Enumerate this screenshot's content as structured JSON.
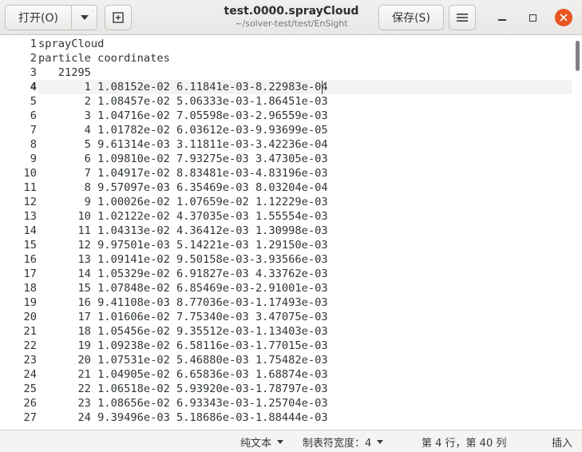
{
  "header": {
    "open_label": "打开(O)",
    "save_label": "保存(S)",
    "title": "test.0000.sprayCloud",
    "subtitle": "~/solver-test/test/EnSight"
  },
  "editor": {
    "current_line": 4,
    "lines": [
      {
        "n": "1",
        "text": "sprayCloud"
      },
      {
        "n": "2",
        "text": "particle coordinates"
      },
      {
        "n": "3",
        "text": "   21295"
      },
      {
        "n": "4",
        "text": "       1 1.08152e-02 6.11841e-03-8.22983e-04"
      },
      {
        "n": "5",
        "text": "       2 1.08457e-02 5.06333e-03-1.86451e-03"
      },
      {
        "n": "6",
        "text": "       3 1.04716e-02 7.05598e-03-2.96559e-03"
      },
      {
        "n": "7",
        "text": "       4 1.01782e-02 6.03612e-03-9.93699e-05"
      },
      {
        "n": "8",
        "text": "       5 9.61314e-03 3.11811e-03-3.42236e-04"
      },
      {
        "n": "9",
        "text": "       6 1.09810e-02 7.93275e-03 3.47305e-03"
      },
      {
        "n": "10",
        "text": "       7 1.04917e-02 8.83481e-03-4.83196e-03"
      },
      {
        "n": "11",
        "text": "       8 9.57097e-03 6.35469e-03 8.03204e-04"
      },
      {
        "n": "12",
        "text": "       9 1.00026e-02 1.07659e-02 1.12229e-03"
      },
      {
        "n": "13",
        "text": "      10 1.02122e-02 4.37035e-03 1.55554e-03"
      },
      {
        "n": "14",
        "text": "      11 1.04313e-02 4.36412e-03 1.30998e-03"
      },
      {
        "n": "15",
        "text": "      12 9.97501e-03 5.14221e-03 1.29150e-03"
      },
      {
        "n": "16",
        "text": "      13 1.09141e-02 9.50158e-03-3.93566e-03"
      },
      {
        "n": "17",
        "text": "      14 1.05329e-02 6.91827e-03 4.33762e-03"
      },
      {
        "n": "18",
        "text": "      15 1.07848e-02 6.85469e-03-2.91001e-03"
      },
      {
        "n": "19",
        "text": "      16 9.41108e-03 8.77036e-03-1.17493e-03"
      },
      {
        "n": "20",
        "text": "      17 1.01606e-02 7.75340e-03 3.47075e-03"
      },
      {
        "n": "21",
        "text": "      18 1.05456e-02 9.35512e-03-1.13403e-03"
      },
      {
        "n": "22",
        "text": "      19 1.09238e-02 6.58116e-03-1.77015e-03"
      },
      {
        "n": "23",
        "text": "      20 1.07531e-02 5.46880e-03 1.75482e-03"
      },
      {
        "n": "24",
        "text": "      21 1.04905e-02 6.65836e-03 1.68874e-03"
      },
      {
        "n": "25",
        "text": "      22 1.06518e-02 5.93920e-03-1.78797e-03"
      },
      {
        "n": "26",
        "text": "      23 1.08656e-02 6.93343e-03-1.25704e-03"
      },
      {
        "n": "27",
        "text": "      24 9.39496e-03 5.18686e-03-1.88444e-03"
      }
    ]
  },
  "status": {
    "syntax": "纯文本",
    "tab_width": "制表符宽度：4",
    "position": "第 4 行，第 40 列",
    "insert_mode": "插入"
  }
}
